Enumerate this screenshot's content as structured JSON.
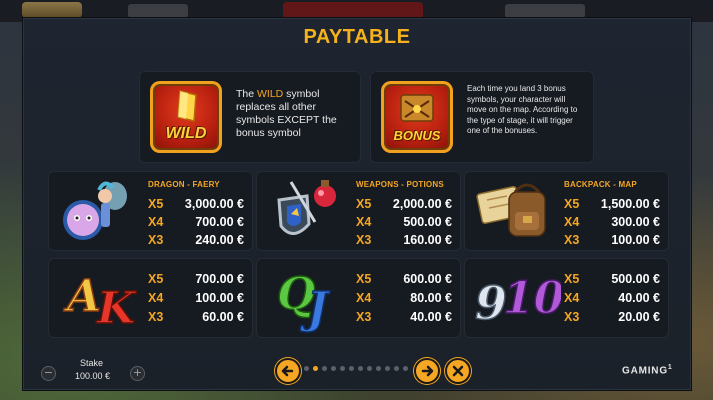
{
  "panel": {
    "title": "PAYTABLE"
  },
  "wild": {
    "icon_label": "WILD",
    "text_pre": "The ",
    "text_accent": "WILD",
    "text_post": " symbol replaces all other symbols EXCEPT the bonus symbol"
  },
  "bonus": {
    "icon_label": "BONUS",
    "text": "Each time you land 3 bonus symbols, your character will move on the map. According to the type of stage, it will trigger one of the bonuses."
  },
  "symbols": [
    {
      "name": "DRAGON - FAERY",
      "art": "dragon-faery-icon",
      "pays": [
        {
          "mult": "X5",
          "value": "3,000.00 €"
        },
        {
          "mult": "X4",
          "value": "700.00 €"
        },
        {
          "mult": "X3",
          "value": "240.00 €"
        }
      ]
    },
    {
      "name": "WEAPONS - POTIONS",
      "art": "weapons-potions-icon",
      "pays": [
        {
          "mult": "X5",
          "value": "2,000.00 €"
        },
        {
          "mult": "X4",
          "value": "500.00 €"
        },
        {
          "mult": "X3",
          "value": "160.00 €"
        }
      ]
    },
    {
      "name": "BACKPACK - MAP",
      "art": "backpack-map-icon",
      "pays": [
        {
          "mult": "X5",
          "value": "1,500.00 €"
        },
        {
          "mult": "X4",
          "value": "300.00 €"
        },
        {
          "mult": "X3",
          "value": "100.00 €"
        }
      ]
    },
    {
      "name": "",
      "art": "ak-letters-icon",
      "pays": [
        {
          "mult": "X5",
          "value": "700.00 €"
        },
        {
          "mult": "X4",
          "value": "100.00 €"
        },
        {
          "mult": "X3",
          "value": "60.00 €"
        }
      ]
    },
    {
      "name": "",
      "art": "qj-letters-icon",
      "pays": [
        {
          "mult": "X5",
          "value": "600.00 €"
        },
        {
          "mult": "X4",
          "value": "80.00 €"
        },
        {
          "mult": "X3",
          "value": "40.00 €"
        }
      ]
    },
    {
      "name": "",
      "art": "number-10-icon",
      "pays": [
        {
          "mult": "X5",
          "value": "500.00 €"
        },
        {
          "mult": "X4",
          "value": "40.00 €"
        },
        {
          "mult": "X3",
          "value": "20.00 €"
        }
      ]
    }
  ],
  "stake": {
    "label": "Stake",
    "value": "100.00 €",
    "minus": "−",
    "plus": "+"
  },
  "pagination": {
    "total_pages": 12,
    "current_page": 2
  },
  "brand": {
    "text": "GAMING",
    "sup": "1"
  },
  "colors": {
    "accent": "#f5a623",
    "panel": "#1e2530",
    "card": "#161b22"
  }
}
